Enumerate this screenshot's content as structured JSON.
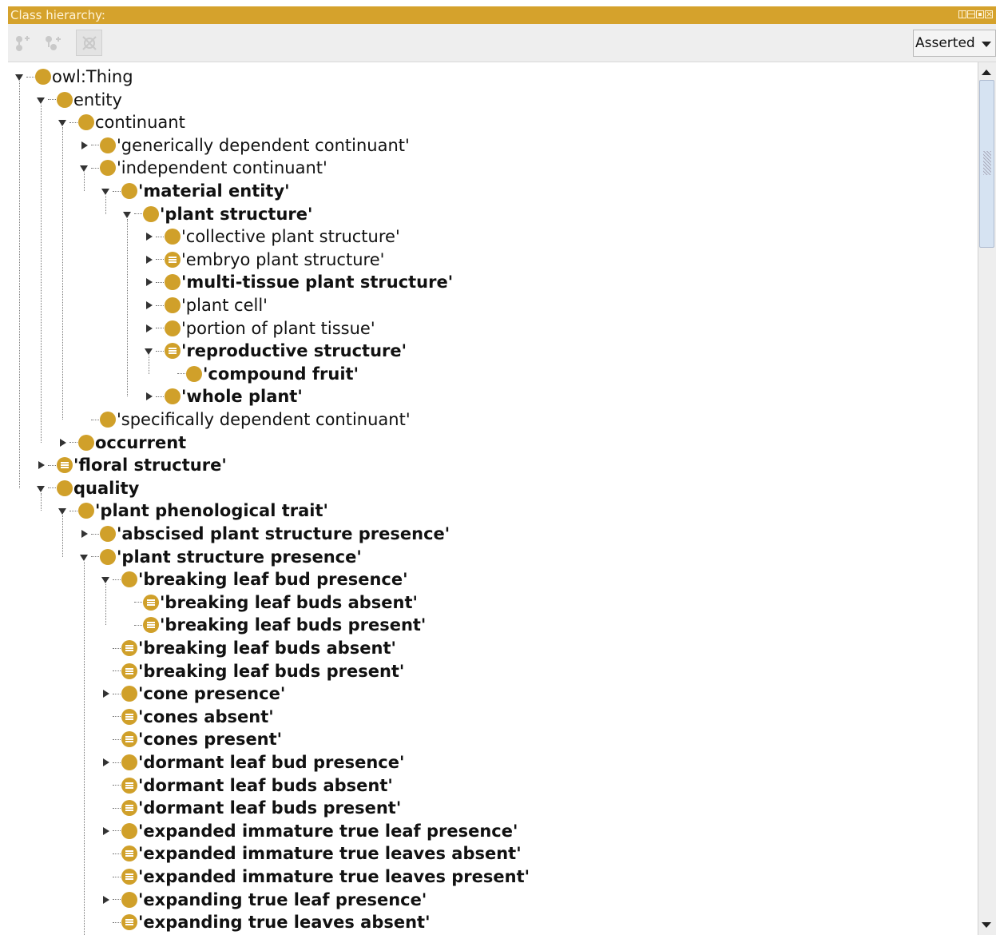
{
  "panel": {
    "title": "Class hierarchy:"
  },
  "toolbar": {
    "buttons": [
      "add-subclass",
      "add-sibling",
      "delete-class"
    ],
    "view_select": "Asserted"
  },
  "colors": {
    "title_bar": "#d5a22c",
    "class_icon": "#d0a02a"
  },
  "tree": [
    {
      "label": "owl:Thing",
      "depth": 0,
      "toggle": "expanded",
      "icon": "class",
      "bold": false
    },
    {
      "label": "entity",
      "depth": 1,
      "toggle": "expanded",
      "icon": "class",
      "bold": false
    },
    {
      "label": "continuant",
      "depth": 2,
      "toggle": "expanded",
      "icon": "class",
      "bold": false
    },
    {
      "label": "'generically dependent continuant'",
      "depth": 3,
      "toggle": "collapsed",
      "icon": "class",
      "bold": false
    },
    {
      "label": "'independent continuant'",
      "depth": 3,
      "toggle": "expanded",
      "icon": "class",
      "bold": false
    },
    {
      "label": "'material entity'",
      "depth": 4,
      "toggle": "expanded",
      "icon": "class",
      "bold": true
    },
    {
      "label": "'plant structure'",
      "depth": 5,
      "toggle": "expanded",
      "icon": "class",
      "bold": true
    },
    {
      "label": "'collective plant structure'",
      "depth": 6,
      "toggle": "collapsed",
      "icon": "class",
      "bold": false
    },
    {
      "label": "'embryo plant structure'",
      "depth": 6,
      "toggle": "collapsed",
      "icon": "defined",
      "bold": false
    },
    {
      "label": "'multi-tissue plant structure'",
      "depth": 6,
      "toggle": "collapsed",
      "icon": "class",
      "bold": true
    },
    {
      "label": "'plant cell'",
      "depth": 6,
      "toggle": "collapsed",
      "icon": "class",
      "bold": false
    },
    {
      "label": "'portion of plant tissue'",
      "depth": 6,
      "toggle": "collapsed",
      "icon": "class",
      "bold": false
    },
    {
      "label": "'reproductive structure'",
      "depth": 6,
      "toggle": "expanded",
      "icon": "defined",
      "bold": true
    },
    {
      "label": "'compound fruit'",
      "depth": 7,
      "toggle": "none",
      "icon": "class",
      "bold": true
    },
    {
      "label": "'whole plant'",
      "depth": 6,
      "toggle": "collapsed",
      "icon": "class",
      "bold": true
    },
    {
      "label": "'specifically dependent continuant'",
      "depth": 3,
      "toggle": "none",
      "icon": "class",
      "bold": false
    },
    {
      "label": "occurrent",
      "depth": 2,
      "toggle": "collapsed",
      "icon": "class",
      "bold": true
    },
    {
      "label": "'floral structure'",
      "depth": 1,
      "toggle": "collapsed",
      "icon": "defined",
      "bold": true
    },
    {
      "label": "quality",
      "depth": 1,
      "toggle": "expanded",
      "icon": "class",
      "bold": true
    },
    {
      "label": "'plant phenological trait'",
      "depth": 2,
      "toggle": "expanded",
      "icon": "class",
      "bold": true
    },
    {
      "label": "'abscised plant structure presence'",
      "depth": 3,
      "toggle": "collapsed",
      "icon": "class",
      "bold": true
    },
    {
      "label": "'plant structure presence'",
      "depth": 3,
      "toggle": "expanded",
      "icon": "class",
      "bold": true
    },
    {
      "label": "'breaking leaf bud presence'",
      "depth": 4,
      "toggle": "expanded",
      "icon": "class",
      "bold": true
    },
    {
      "label": "'breaking leaf buds absent'",
      "depth": 5,
      "toggle": "none",
      "icon": "defined",
      "bold": true
    },
    {
      "label": "'breaking leaf buds present'",
      "depth": 5,
      "toggle": "none",
      "icon": "defined",
      "bold": true
    },
    {
      "label": "'breaking leaf buds absent'",
      "depth": 4,
      "toggle": "none",
      "icon": "defined",
      "bold": true
    },
    {
      "label": "'breaking leaf buds present'",
      "depth": 4,
      "toggle": "none",
      "icon": "defined",
      "bold": true
    },
    {
      "label": "'cone presence'",
      "depth": 4,
      "toggle": "collapsed",
      "icon": "class",
      "bold": true
    },
    {
      "label": "'cones absent'",
      "depth": 4,
      "toggle": "none",
      "icon": "defined",
      "bold": true
    },
    {
      "label": "'cones present'",
      "depth": 4,
      "toggle": "none",
      "icon": "defined",
      "bold": true
    },
    {
      "label": "'dormant leaf bud presence'",
      "depth": 4,
      "toggle": "collapsed",
      "icon": "class",
      "bold": true
    },
    {
      "label": "'dormant leaf buds absent'",
      "depth": 4,
      "toggle": "none",
      "icon": "defined",
      "bold": true
    },
    {
      "label": "'dormant leaf buds present'",
      "depth": 4,
      "toggle": "none",
      "icon": "defined",
      "bold": true
    },
    {
      "label": "'expanded immature true leaf presence'",
      "depth": 4,
      "toggle": "collapsed",
      "icon": "class",
      "bold": true
    },
    {
      "label": "'expanded immature true leaves absent'",
      "depth": 4,
      "toggle": "none",
      "icon": "defined",
      "bold": true
    },
    {
      "label": "'expanded immature true leaves present'",
      "depth": 4,
      "toggle": "none",
      "icon": "defined",
      "bold": true
    },
    {
      "label": "'expanding true leaf presence'",
      "depth": 4,
      "toggle": "collapsed",
      "icon": "class",
      "bold": true
    },
    {
      "label": "'expanding true leaves absent'",
      "depth": 4,
      "toggle": "none",
      "icon": "defined",
      "bold": true
    }
  ]
}
